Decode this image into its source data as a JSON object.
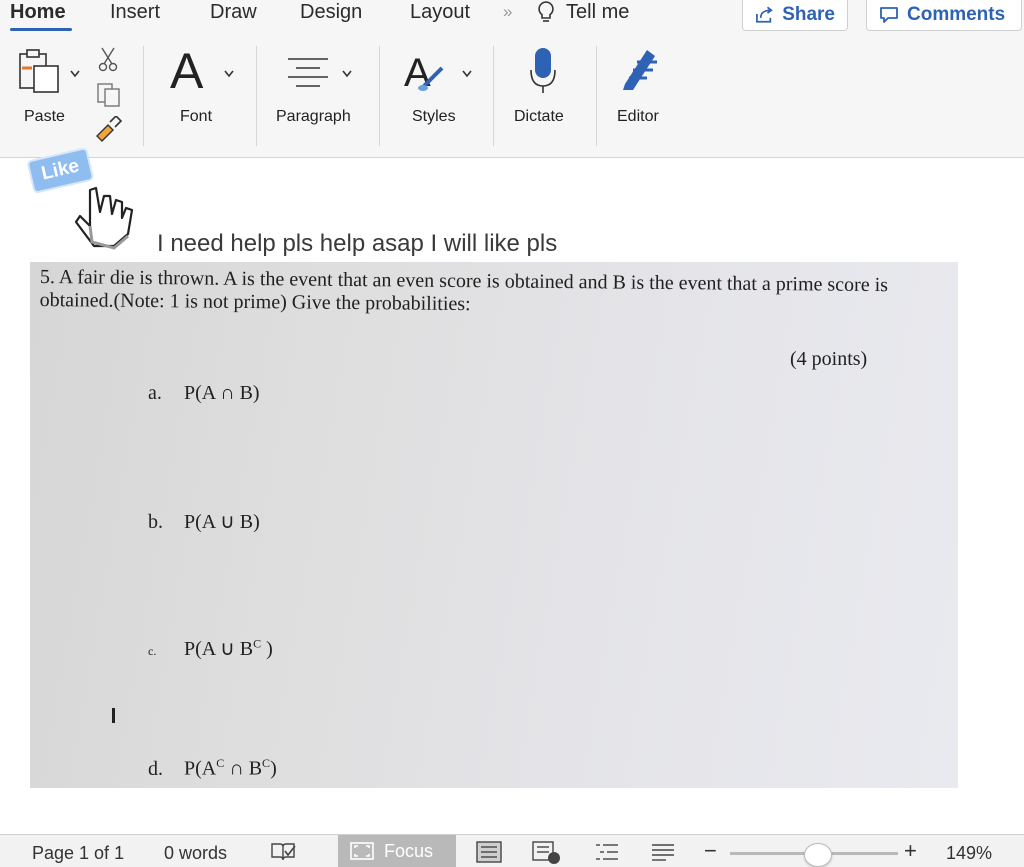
{
  "tabs": [
    {
      "label": "Home",
      "active": true
    },
    {
      "label": "Insert"
    },
    {
      "label": "Draw"
    },
    {
      "label": "Design"
    },
    {
      "label": "Layout"
    }
  ],
  "tab_overflow": "»",
  "tell_me": {
    "label": "Tell me",
    "icon": "lightbulb-icon"
  },
  "header_buttons": {
    "share": "Share",
    "comments": "Comments"
  },
  "ribbon": {
    "paste": "Paste",
    "font": "Font",
    "font_glyph": "A",
    "paragraph": "Paragraph",
    "styles": "Styles",
    "dictate": "Dictate",
    "editor": "Editor"
  },
  "document": {
    "like_badge": "Like",
    "heading": "I need help pls help asap I will like pls",
    "question": "5. A fair die is thrown. A is the event that an even score is obtained and B is the event that a prime score is obtained.(Note: 1 is not prime) Give the probabilities:",
    "points": "(4 points)",
    "items": [
      {
        "letter": "a.",
        "expr": "P(A ∩ B)"
      },
      {
        "letter": "b.",
        "expr": "P(A ∪ B)"
      },
      {
        "letter": "c.",
        "expr_main": "P(A ∪ B",
        "expr_sup": "C",
        "expr_end": " )"
      },
      {
        "letter": "d.",
        "expr_a": "P(A",
        "expr_sup1": "C",
        "expr_mid": " ∩ B",
        "expr_sup2": "C",
        "expr_end": ")"
      }
    ]
  },
  "status_bar": {
    "page": "Page 1 of 1",
    "words": "0 words",
    "focus": "Focus",
    "zoom": "149%",
    "zoom_minus": "−",
    "zoom_plus": "+"
  },
  "colors": {
    "accent": "#2e62b5",
    "like_badge": "#8fbdf0"
  }
}
